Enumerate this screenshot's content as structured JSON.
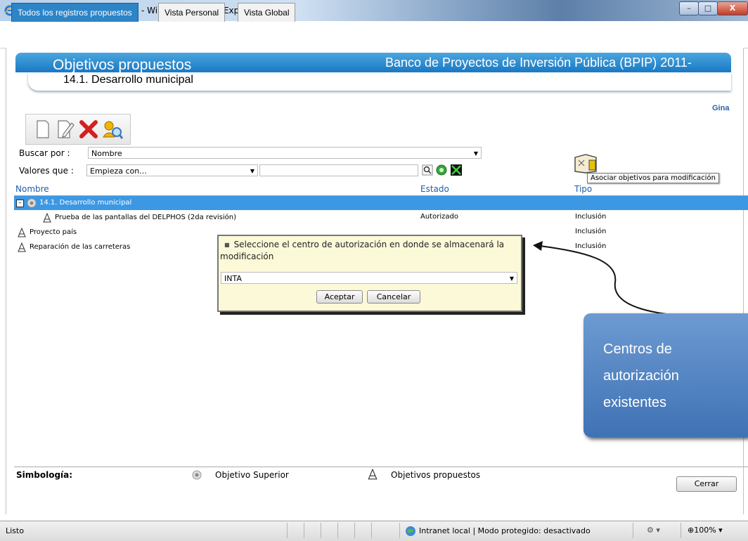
{
  "window": {
    "title": "DELPHOS (www.deinsa.com) - Windows Internet Explorer",
    "close_glyph": "X"
  },
  "tabs": [
    {
      "label": "Todos los registros propuestos"
    },
    {
      "label": "Vista Personal"
    },
    {
      "label": "Vista Global"
    }
  ],
  "header": {
    "title": "Objetivos propuestos",
    "right": "Banco de Proyectos de Inversión Pública (BPIP) 2011-",
    "subtitle": "14.1. Desarrollo municipal",
    "user": "Gina"
  },
  "toolbar": {
    "icons": [
      "new-document-icon",
      "edit-icon",
      "delete-icon",
      "search-user-icon"
    ]
  },
  "search": {
    "buscar_label": "Buscar por :",
    "buscar_value": "Nombre",
    "valores_label": "Valores que :",
    "valores_value": "Empieza con...",
    "text_value": "",
    "associate_tooltip": "Asociar objetivos para modificación"
  },
  "grid": {
    "columns": [
      "Nombre",
      "Estado",
      "Tipo"
    ],
    "group": "14.1. Desarrollo municipal",
    "rows": [
      {
        "nombre": "Prueba de las pantallas del DELPHOS (2da revisión)",
        "estado": "Autorizado",
        "tipo": "Inclusión"
      },
      {
        "nombre": "Proyecto país",
        "estado": "",
        "tipo": "Inclusión"
      },
      {
        "nombre": "Reparación de las carreteras",
        "estado": "",
        "tipo": "Inclusión"
      }
    ]
  },
  "dialog": {
    "message": "Seleccione el centro de autorización en donde se almacenará la modificación",
    "selected": "INTA",
    "accept": "Aceptar",
    "cancel": "Cancelar"
  },
  "callout": {
    "text": "Centros de autorización existentes"
  },
  "legend": {
    "label": "Simbología:",
    "item1": "Objetivo Superior",
    "item2": "Objetivos propuestos",
    "close": "Cerrar"
  },
  "statusbar": {
    "left": "Listo",
    "zone": "Intranet local | Modo protegido: desactivado",
    "zoom": "100%"
  },
  "colors": {
    "banner": "#1a78c2",
    "group_row": "#3d98e3",
    "dialog_bg": "#fbf9d8",
    "callout_bg": "#4f80c2"
  }
}
